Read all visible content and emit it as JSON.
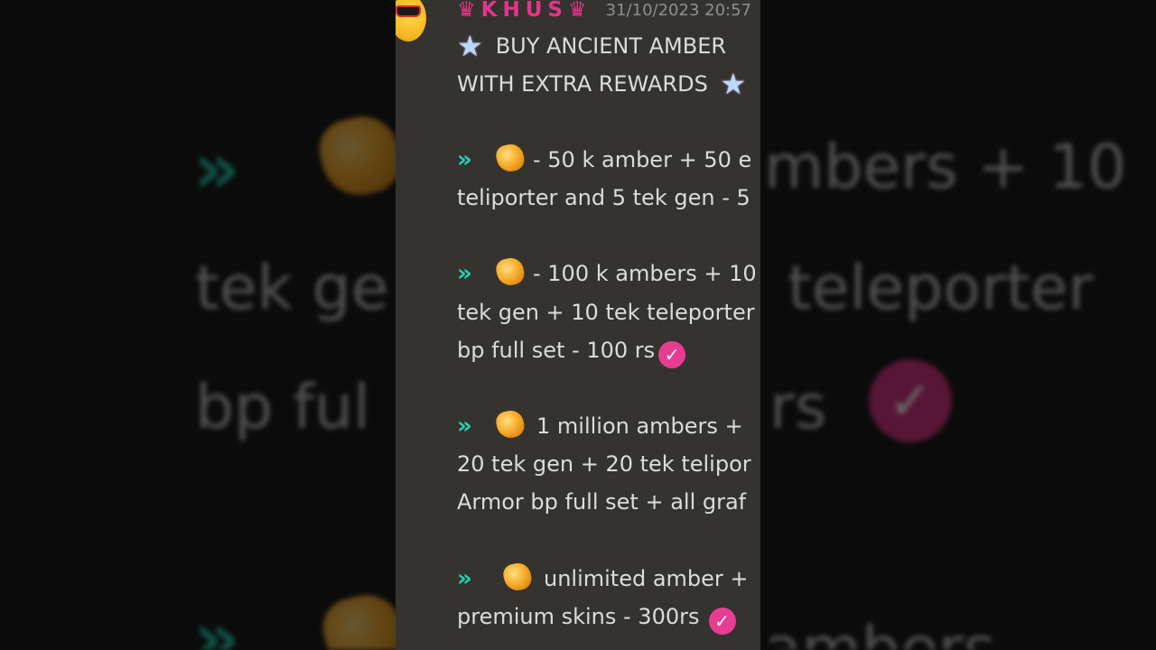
{
  "message": {
    "username": "♛KHUS♛",
    "timestamp": "31/10/2023 20:57",
    "avatar_icon": "sunglasses-emoji-icon",
    "title_line1": "BUY ANCIENT AMBER",
    "title_line2": "WITH EXTRA REWARDS",
    "offers": [
      {
        "line1": "- 50 k  amber + 50 e",
        "line2": "teliporter and 5 tek gen - 5"
      },
      {
        "line1": "- 100 k ambers + 10",
        "line2": "tek gen + 10 tek teleporter",
        "line3": "bp full set - 100 rs"
      },
      {
        "line1": "1 million ambers +",
        "line2": "20 tek gen + 20 tek telipor",
        "line3": "Armor bp full set + all graf"
      },
      {
        "line1": "unlimited amber +",
        "line2": "premium skins - 300rs"
      }
    ]
  },
  "background": {
    "line1": "mbers + 10",
    "line2a": "tek ge",
    "line2b": "teleporter",
    "line3a": "bp ful",
    "line3b": "rs",
    "line4": "ambers"
  },
  "icons": {
    "chevron": "»",
    "star": "★",
    "check": "✓"
  },
  "colors": {
    "panel_bg": "#34332f",
    "username": "#e7338a",
    "chevron": "#25d3b3",
    "badge": "#e63d93",
    "text": "#dcdcd8"
  }
}
